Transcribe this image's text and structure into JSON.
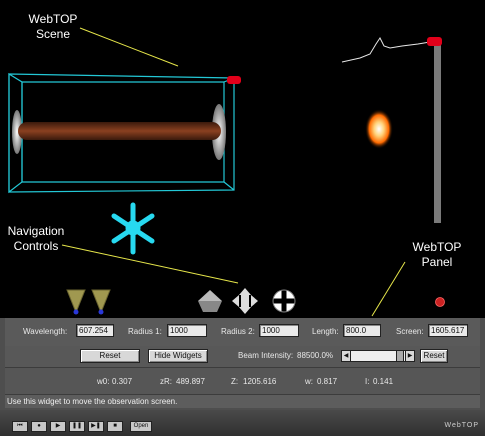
{
  "callouts": {
    "scene": "WebTOP\nScene",
    "navigation": "Navigation\nControls",
    "panel": "WebTOP\nPanel"
  },
  "panel": {
    "wavelength_label": "Wavelength:",
    "wavelength_value": "607.254",
    "radius1_label": "Radius 1:",
    "radius1_value": "1000",
    "radius2_label": "Radius 2:",
    "radius2_value": "1000",
    "length_label": "Length:",
    "length_value": "800.0",
    "screen_label": "Screen:",
    "screen_value": "1605.617",
    "reset_label": "Reset",
    "hide_widgets_label": "Hide Widgets",
    "beam_intensity_label": "Beam Intensity:",
    "beam_intensity_value": "88500.0%",
    "beam_reset_label": "Reset",
    "w0_label": "w0:",
    "w0_value": "0.307",
    "zr_label": "zR:",
    "zr_value": "489.897",
    "z_label": "Z:",
    "z_value": "1205.616",
    "w_label": "w:",
    "w_value": "0.817",
    "i_label": "I:",
    "i_value": "0.141",
    "status": "Use this widget to move the observation screen.",
    "brand": "WebTOP",
    "open_label": "Open"
  },
  "colors": {
    "cavity_outline": "#23c8d6",
    "rod": "#5a2a14",
    "nav_icon": "#27d9f0",
    "callout_line": "#e6e64a",
    "handle": "#e2001a"
  }
}
